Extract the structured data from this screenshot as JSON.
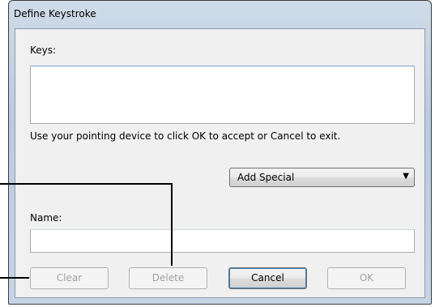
{
  "window": {
    "title": "Define Keystroke"
  },
  "keys": {
    "label": "Keys:",
    "value": ""
  },
  "instructions": "Use your pointing device to click OK to accept or Cancel to exit.",
  "add_special": {
    "selected": "Add Special",
    "arrow_icon": "dropdown-arrow-icon"
  },
  "name": {
    "label": "Name:",
    "value": ""
  },
  "buttons": {
    "clear": "Clear",
    "delete": "Delete",
    "cancel": "Cancel",
    "ok": "OK"
  }
}
